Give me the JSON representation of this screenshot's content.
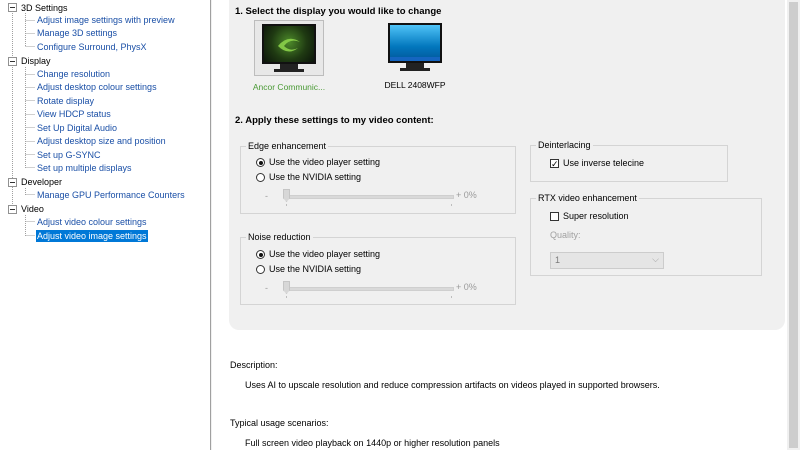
{
  "tree": {
    "categories": [
      {
        "label": "3D Settings",
        "items": [
          "Adjust image settings with preview",
          "Manage 3D settings",
          "Configure Surround, PhysX"
        ]
      },
      {
        "label": "Display",
        "items": [
          "Change resolution",
          "Adjust desktop colour settings",
          "Rotate display",
          "View HDCP status",
          "Set Up Digital Audio",
          "Adjust desktop size and position",
          "Set up G-SYNC",
          "Set up multiple displays"
        ]
      },
      {
        "label": "Developer",
        "items": [
          "Manage GPU Performance Counters"
        ]
      },
      {
        "label": "Video",
        "items": [
          "Adjust video colour settings",
          "Adjust video image settings"
        ]
      }
    ],
    "selected": "Adjust video image settings"
  },
  "section1": {
    "heading": "1. Select the display you would like to change",
    "displays": [
      {
        "label": "Ancor Communic...",
        "icon": "nvidia-monitor-icon",
        "selected": true
      },
      {
        "label": "DELL 2408WFP",
        "icon": "windows-monitor-icon",
        "selected": false
      }
    ]
  },
  "section2": {
    "heading": "2. Apply these settings to my video content:",
    "edge": {
      "title": "Edge enhancement",
      "option_player": "Use the video player setting",
      "option_nvidia": "Use the NVIDIA setting",
      "selected": "player",
      "minus": "-",
      "value": "+ 0%"
    },
    "noise": {
      "title": "Noise reduction",
      "option_player": "Use the video player setting",
      "option_nvidia": "Use the NVIDIA setting",
      "selected": "player",
      "minus": "-",
      "value": "+ 0%"
    },
    "deinterlacing": {
      "title": "Deinterlacing",
      "checkbox_label": "Use inverse telecine",
      "checked": true
    },
    "rtx": {
      "title": "RTX video enhancement",
      "checkbox_label": "Super resolution",
      "checked": false,
      "quality_label": "Quality:",
      "quality_value": "1"
    }
  },
  "description": {
    "label": "Description:",
    "text": "Uses AI to upscale resolution and reduce compression artifacts on videos played in supported browsers."
  },
  "usage": {
    "label": "Typical usage scenarios:",
    "text": "Full screen video playback on 1440p or higher resolution panels"
  },
  "colors": {
    "selection": "#0078d7",
    "link": "#1a4fa6",
    "nvidia_green": "#4a9a35"
  }
}
